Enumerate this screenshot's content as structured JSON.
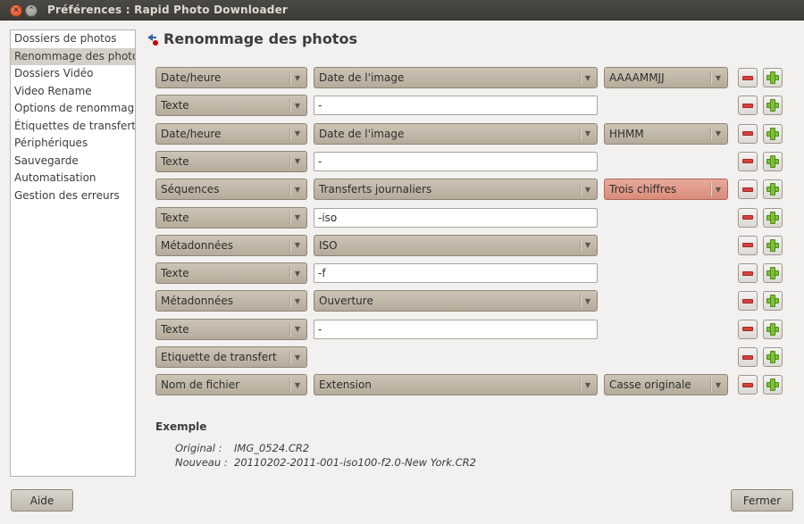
{
  "window": {
    "title": "Préférences : Rapid Photo Downloader"
  },
  "sidebar": {
    "items": [
      {
        "label": "Dossiers de photos"
      },
      {
        "label": "Renommage des photos",
        "selected": true
      },
      {
        "label": "Dossiers Vidéo"
      },
      {
        "label": "Video Rename"
      },
      {
        "label": "Options de renommage"
      },
      {
        "label": "Étiquettes de transfert"
      },
      {
        "label": "Périphériques"
      },
      {
        "label": "Sauvegarde"
      },
      {
        "label": "Automatisation"
      },
      {
        "label": "Gestion des erreurs"
      }
    ]
  },
  "header": {
    "title": "Renommage des photos"
  },
  "rows": [
    {
      "c1": "Date/heure",
      "c2": "Date de l'image",
      "c3": "AAAAMMJJ"
    },
    {
      "c1": "Texte",
      "text": "-"
    },
    {
      "c1": "Date/heure",
      "c2": "Date de l'image",
      "c3": "HHMM"
    },
    {
      "c1": "Texte",
      "text": "-"
    },
    {
      "c1": "Séquences",
      "c2": "Transferts journaliers",
      "c3": "Trois chiffres"
    },
    {
      "c1": "Texte",
      "text": "-iso"
    },
    {
      "c1": "Métadonnées",
      "c2": "ISO"
    },
    {
      "c1": "Texte",
      "text": "-f"
    },
    {
      "c1": "Métadonnées",
      "c2": "Ouverture"
    },
    {
      "c1": "Texte",
      "text": "-"
    },
    {
      "c1": "Etiquette de transfert"
    },
    {
      "c1": "Nom de fichier",
      "c2": "Extension",
      "c3": "Casse originale"
    }
  ],
  "example": {
    "title": "Exemple",
    "original_label": "Original :",
    "original_value": "IMG_0524.CR2",
    "new_label": "Nouveau :",
    "new_value": "20110202-2011-001-iso100-f2.0-New York.CR2"
  },
  "buttons": {
    "help": "Aide",
    "close": "Fermer"
  },
  "colors": {
    "warning_combo": "#e0997f",
    "accent_plus": "#7fbf3a",
    "accent_minus": "#d7413c"
  }
}
